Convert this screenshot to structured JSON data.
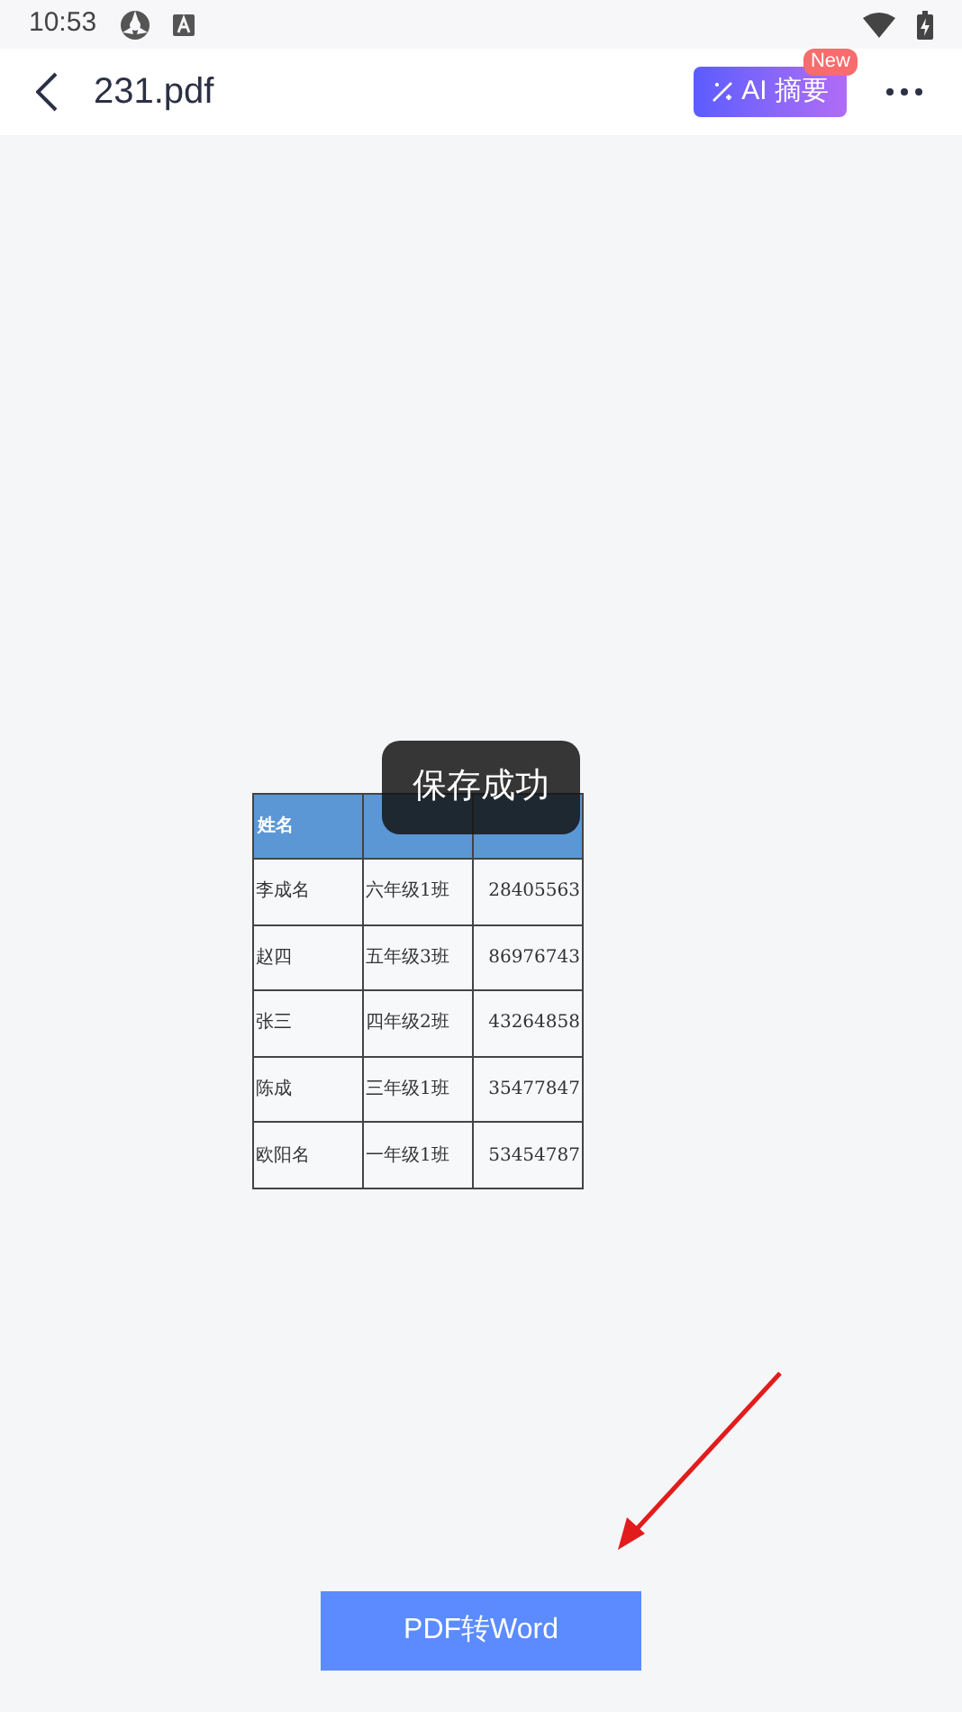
{
  "status_bar": {
    "time": "10:53"
  },
  "header": {
    "title": "231.pdf",
    "ai_button": {
      "label": "AI 摘要",
      "badge": "New"
    }
  },
  "table": {
    "columns": [
      "姓名"
    ],
    "rows": [
      [
        "李成名",
        "六年级1班",
        "28405563"
      ],
      [
        "赵四",
        "五年级3班",
        "86976743"
      ],
      [
        "张三",
        "四年级2班",
        "43264858"
      ],
      [
        "陈成",
        "三年级1班",
        "35477847"
      ],
      [
        "欧阳名",
        "一年级1班",
        "53454787"
      ]
    ]
  },
  "toast": {
    "text": "保存成功"
  },
  "convert_button": {
    "label": "PDF转Word"
  }
}
